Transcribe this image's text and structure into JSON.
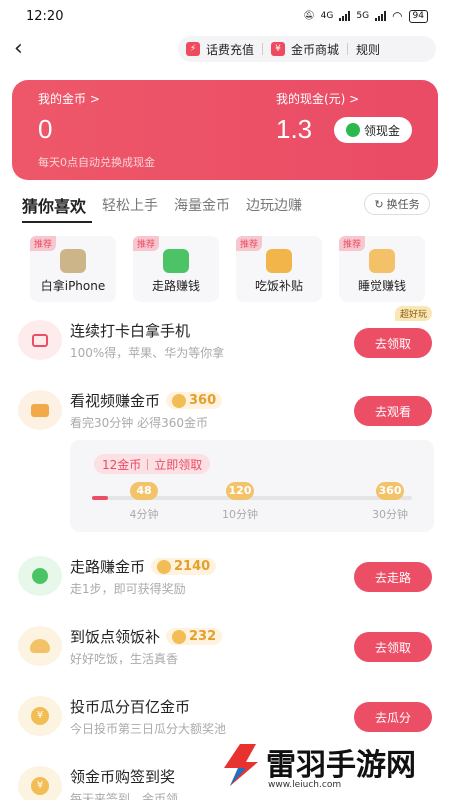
{
  "status": {
    "time": "12:20",
    "net1": "4G",
    "net2": "5G",
    "battery": "94"
  },
  "header": {
    "items": [
      {
        "label": "话费充值",
        "icon": "charge-icon"
      },
      {
        "label": "金币商城",
        "icon": "mall-icon"
      },
      {
        "label": "规则"
      }
    ]
  },
  "card": {
    "coins_label": "我的金币 >",
    "coins_value": "0",
    "cash_label": "我的现金(元) >",
    "cash_value": "1.3",
    "cash_button": "领现金",
    "note": "每天0点自动兑换成现金"
  },
  "tabs": {
    "items": [
      "猜你喜欢",
      "轻松上手",
      "海量金币",
      "边玩边赚"
    ],
    "swap": "换任务"
  },
  "quick": [
    {
      "tag": "推荐",
      "label": "白拿iPhone",
      "color": "#cdb58a"
    },
    {
      "tag": "推荐",
      "label": "走路赚钱",
      "color": "#4cc466"
    },
    {
      "tag": "推荐",
      "label": "吃饭补贴",
      "color": "#f1b54a"
    },
    {
      "tag": "推荐",
      "label": "睡觉赚钱",
      "color": "#f3c168"
    }
  ],
  "tasks": {
    "t1": {
      "title": "连续打卡白拿手机",
      "sub": "100%得，苹果、华为等你拿",
      "btn": "去领取",
      "hot": "超好玩"
    },
    "t2": {
      "title": "看视频赚金币",
      "coins": "360",
      "sub": "看完30分钟 必得360金币",
      "btn": "去观看"
    },
    "t3": {
      "title": "走路赚金币",
      "coins": "2140",
      "sub": "走1步，即可获得奖励",
      "btn": "去走路"
    },
    "t4": {
      "title": "到饭点领饭补",
      "coins": "232",
      "sub": "好好吃饭，生活真香",
      "btn": "去领取"
    },
    "t5": {
      "title": "投币瓜分百亿金币",
      "sub": "今日投币第三日瓜分大额奖池",
      "btn": "去瓜分"
    },
    "t6": {
      "title": "领金币购签到奖",
      "sub": "每天来签到，金币领"
    }
  },
  "progress": {
    "pill_a": "12金币",
    "pill_b": "立即领取",
    "fill_fraction": 0.05,
    "nodes": [
      {
        "coins": "48",
        "time": "4分钟"
      },
      {
        "coins": "120",
        "time": "10分钟"
      },
      {
        "coins": "360",
        "time": "30分钟"
      }
    ]
  },
  "watermark": {
    "name": "雷羽手游网",
    "url": "www.leiuch.com"
  }
}
